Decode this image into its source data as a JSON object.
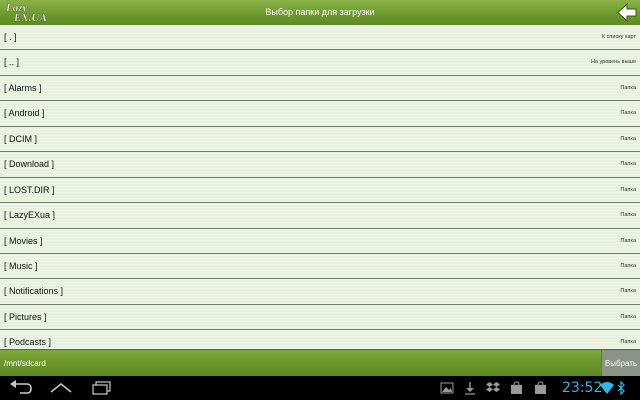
{
  "header": {
    "logo_text": "LazyEX.UA",
    "title": "Выбор папки для загрузки"
  },
  "folders": [
    {
      "name": "[ . ]",
      "type": "К списку карт"
    },
    {
      "name": "[ .. ]",
      "type": "На уровень выше"
    },
    {
      "name": "[ Alarms ]",
      "type": "Папка"
    },
    {
      "name": "[ Android ]",
      "type": "Папка"
    },
    {
      "name": "[ DCIM ]",
      "type": "Папка"
    },
    {
      "name": "[ Download ]",
      "type": "Папка"
    },
    {
      "name": "[ LOST.DIR ]",
      "type": "Папка"
    },
    {
      "name": "[ LazyEXua ]",
      "type": "Папка"
    },
    {
      "name": "[ Movies ]",
      "type": "Папка"
    },
    {
      "name": "[ Music ]",
      "type": "Папка"
    },
    {
      "name": "[ Notifications ]",
      "type": "Папка"
    },
    {
      "name": "[ Pictures ]",
      "type": "Папка"
    },
    {
      "name": "[ Podcasts ]",
      "type": "Папка"
    }
  ],
  "footer": {
    "path": "/mnt/sdcard",
    "select_label": "Выбрать"
  },
  "system_bar": {
    "clock": "23:52",
    "nav_icons": [
      "back-icon",
      "home-icon",
      "recent-apps-icon"
    ],
    "notification_icons": [
      "gallery-icon",
      "download-icon",
      "dropbox-icon",
      "shop-bag-icon",
      "shop-bag-icon",
      "wifi-icon",
      "bluetooth-icon"
    ],
    "accent_color": "#33b5e5"
  },
  "colors": {
    "header_green": "#6e9a2d",
    "list_background": "#e7f1dd",
    "select_button": "#8a9386"
  }
}
